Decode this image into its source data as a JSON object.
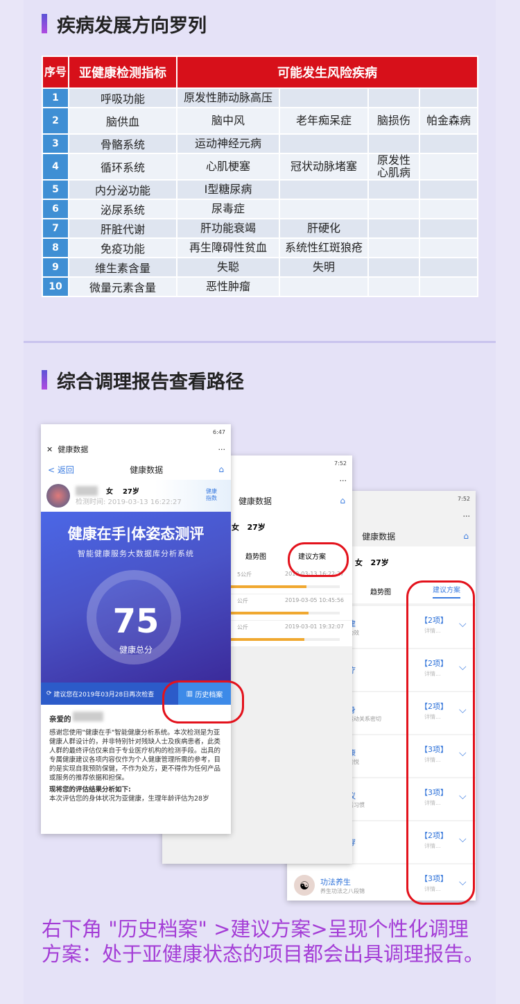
{
  "section1": {
    "title": "疾病发展方向罗列"
  },
  "table": {
    "headers": {
      "no": "序号",
      "indicator": "亚健康检测指标",
      "diseases": "可能发生风险疾病"
    },
    "rows": [
      {
        "no": "1",
        "indicator": "呼吸功能",
        "d": [
          "原发性肺动脉高压",
          "",
          "",
          ""
        ]
      },
      {
        "no": "2",
        "indicator": "脑供血",
        "d": [
          "脑中风",
          "老年痴呆症",
          "脑损伤",
          "帕金森病"
        ]
      },
      {
        "no": "3",
        "indicator": "骨骼系统",
        "d": [
          "运动神经元病",
          "",
          "",
          ""
        ]
      },
      {
        "no": "4",
        "indicator": "循环系统",
        "d": [
          "心肌梗塞",
          "冠状动脉堵塞",
          "原发性\n心肌病",
          ""
        ]
      },
      {
        "no": "5",
        "indicator": "内分泌功能",
        "d": [
          "I型糖尿病",
          "",
          "",
          ""
        ]
      },
      {
        "no": "6",
        "indicator": "泌尿系统",
        "d": [
          "尿毒症",
          "",
          "",
          ""
        ]
      },
      {
        "no": "7",
        "indicator": "肝脏代谢",
        "d": [
          "肝功能衰竭",
          "肝硬化",
          "",
          ""
        ]
      },
      {
        "no": "8",
        "indicator": "免疫功能",
        "d": [
          "再生障碍性贫血",
          "系统性红斑狼疮",
          "",
          ""
        ]
      },
      {
        "no": "9",
        "indicator": "维生素含量",
        "d": [
          "失聪",
          "失明",
          "",
          ""
        ]
      },
      {
        "no": "10",
        "indicator": "微量元素含量",
        "d": [
          "恶性肿瘤",
          "",
          "",
          ""
        ]
      }
    ]
  },
  "section2": {
    "title": "综合调理报告查看路径"
  },
  "phone1": {
    "time": "6:47",
    "topbar": "健康数据",
    "more": "···",
    "back": "< 返回",
    "nav_title": "健康数据",
    "gender": "女",
    "age": "27岁",
    "check_time": "检测时间: 2019-03-13 16:22:27",
    "health_index": "健康指数",
    "banner_title": "健康在手|体姿态测评",
    "banner_sub": "智能健康服务大数据库分析系统",
    "score": "75",
    "score_label": "健康总分",
    "recheck": "建议您在2019年03月28日再次检查",
    "history": "历史档案",
    "greeting": "亲爱的",
    "letter": "感谢您使用\"健康在手\"智能健康分析系统。本次检测是为亚健康人群设计的，并非特别针对残缺人士及疾病患者，此类人群的最终评估仅来自于专业医疗机构的检测手段。出具的专属健康建议各项内容仅作为个人健康管理所需的参考，目的是实现自我预防保健，不作为处方，更不得作为任何产品或服务的推荐依据和担保。",
    "result_title": "现将您的评估结果分析如下:",
    "result": "本次评估您的身体状况为亚健康，生理年龄评估为28岁"
  },
  "phone2": {
    "time": "7:52",
    "more": "···",
    "nav_title": "健康数据",
    "gender": "女",
    "age": "27岁",
    "tab_trend": "趋势图",
    "tab_advice": "建议方案",
    "records": [
      {
        "w": "5公斤",
        "t": "2019-03-13 16:22:27",
        "p": 0.7
      },
      {
        "w": "公斤",
        "t": "2019-03-05 10:45:56",
        "p": 0.72
      },
      {
        "w": "公斤",
        "t": "2019-03-01 19:32:07",
        "p": 0.68
      }
    ]
  },
  "phone3": {
    "time": "7:52",
    "more": "···",
    "nav_title": "健康数据",
    "gender": "女",
    "age": "27岁",
    "tab_trend": "趋势图",
    "tab_advice": "建议方案",
    "items": [
      {
        "name": "建",
        "sub": "功效",
        "count": "【2项】",
        "detail": "详情..."
      },
      {
        "name": "疗",
        "sub": "",
        "count": "【2项】",
        "detail": "详情..."
      },
      {
        "name": "身",
        "sub": "运动关系密切",
        "count": "【2项】",
        "detail": "详情..."
      },
      {
        "name": "康",
        "sub": "愉悦",
        "count": "【3项】",
        "detail": "详情..."
      },
      {
        "name": "议",
        "sub": "活习惯",
        "count": "【3项】",
        "detail": "详情..."
      },
      {
        "name": "穿",
        "sub": "",
        "count": "【2项】",
        "detail": "详情..."
      },
      {
        "name": "功法养生",
        "sub": "养生功法之八段锦",
        "count": "【3项】",
        "detail": "详情..."
      }
    ]
  },
  "caption": "右下角 \"历史档案\" >建议方案>呈现个性化调理方案：处于亚健康状态的项目都会出具调理报告。"
}
